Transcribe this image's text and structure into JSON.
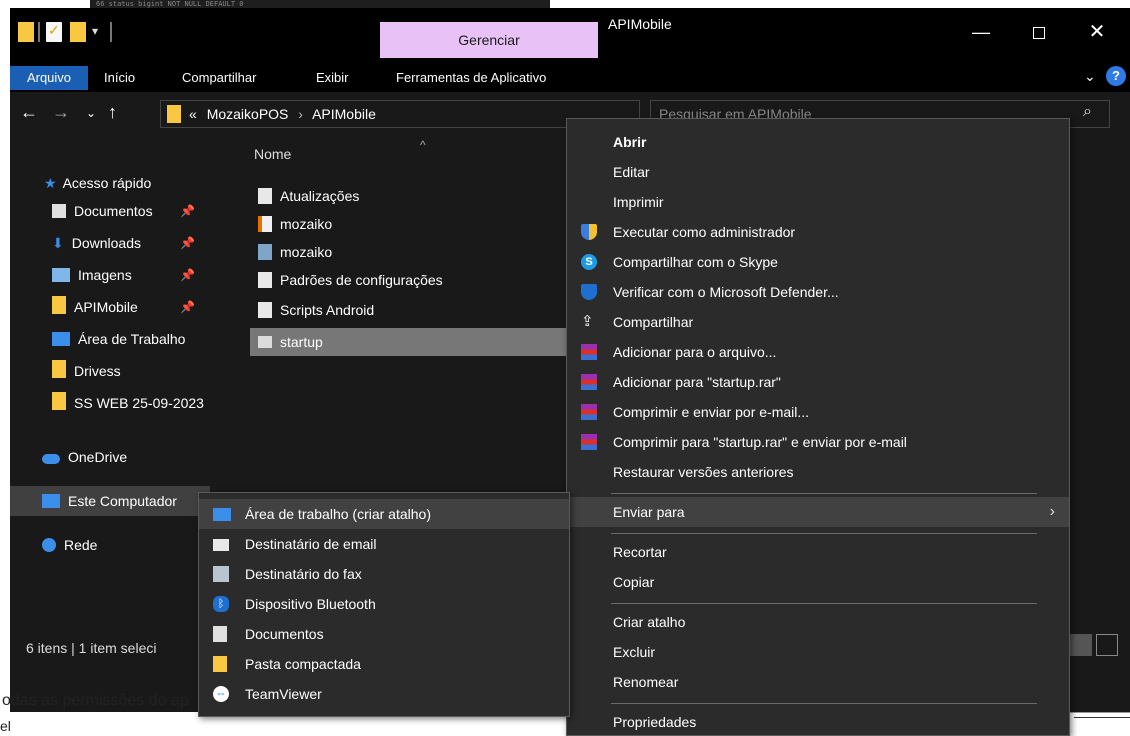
{
  "background": {
    "code_snippet": "66    status bigint NOT NULL DEFAULT 0",
    "under_text": "odas as permissões do ap",
    "under_text2": "el"
  },
  "window": {
    "title": "APIMobile",
    "manage_tab": "Gerenciar",
    "quick_access_dropdown": "▾"
  },
  "ribbon": {
    "tabs": [
      {
        "label": "Arquivo"
      },
      {
        "label": "Início"
      },
      {
        "label": "Compartilhar"
      },
      {
        "label": "Exibir"
      },
      {
        "label": "Ferramentas de Aplicativo"
      }
    ],
    "help": "?"
  },
  "address": {
    "path_prefix": "«",
    "path": [
      "MozaikoPOS",
      "APIMobile"
    ],
    "search_placeholder": "Pesquisar em APIMobile"
  },
  "navigation": {
    "items": [
      {
        "label": "Acesso rápido",
        "icon": "star-icon",
        "pinned": false
      },
      {
        "label": "Documentos",
        "icon": "documents-icon",
        "pinned": true
      },
      {
        "label": "Downloads",
        "icon": "download-icon",
        "pinned": true
      },
      {
        "label": "Imagens",
        "icon": "images-icon",
        "pinned": true
      },
      {
        "label": "APIMobile",
        "icon": "folder-icon",
        "pinned": true
      },
      {
        "label": "Área de Trabalho",
        "icon": "desktop-icon",
        "pinned": false
      },
      {
        "label": "Drivess",
        "icon": "folder-icon",
        "pinned": false
      },
      {
        "label": "SS WEB 25-09-2023",
        "icon": "folder-icon",
        "pinned": false
      },
      {
        "label": "OneDrive",
        "icon": "onedrive-icon",
        "pinned": false
      },
      {
        "label": "Este Computador",
        "icon": "computer-icon",
        "pinned": false
      },
      {
        "label": "Rede",
        "icon": "network-icon",
        "pinned": false
      }
    ]
  },
  "files": {
    "column_name": "Nome",
    "items": [
      {
        "name": "Atualizações",
        "icon": "text-file-icon"
      },
      {
        "name": "mozaiko",
        "icon": "java-file-icon"
      },
      {
        "name": "mozaiko",
        "icon": "archive-file-icon"
      },
      {
        "name": "Padrões de configurações",
        "icon": "text-file-icon"
      },
      {
        "name": "Scripts Android",
        "icon": "text-file-icon"
      },
      {
        "name": "startup",
        "icon": "batch-file-icon",
        "selected": true
      }
    ]
  },
  "status": {
    "text": "6 itens  |  1 item seleci"
  },
  "context_menu": {
    "items": [
      {
        "label": "Abrir",
        "bold": true
      },
      {
        "label": "Editar"
      },
      {
        "label": "Imprimir"
      },
      {
        "label": "Executar como administrador",
        "icon": "shield-icon"
      },
      {
        "label": "Compartilhar com o Skype",
        "icon": "skype-icon"
      },
      {
        "label": "Verificar com o Microsoft Defender...",
        "icon": "defender-icon"
      },
      {
        "label": "Compartilhar",
        "icon": "share-icon"
      },
      {
        "label": "Adicionar para o arquivo...",
        "icon": "winrar-icon"
      },
      {
        "label": "Adicionar para \"startup.rar\"",
        "icon": "winrar-icon"
      },
      {
        "label": "Comprimir e enviar por e-mail...",
        "icon": "winrar-icon"
      },
      {
        "label": "Comprimir para \"startup.rar\" e enviar por e-mail",
        "icon": "winrar-icon"
      },
      {
        "label": "Restaurar versões anteriores"
      },
      {
        "label": "Enviar para",
        "submenu": true
      },
      {
        "label": "Recortar"
      },
      {
        "label": "Copiar"
      },
      {
        "label": "Criar atalho"
      },
      {
        "label": "Excluir"
      },
      {
        "label": "Renomear"
      },
      {
        "label": "Propriedades"
      }
    ],
    "submenu_arrow": "›"
  },
  "sendto_menu": {
    "items": [
      {
        "label": "Área de trabalho (criar atalho)",
        "icon": "desktop-icon"
      },
      {
        "label": "Destinatário de email",
        "icon": "mail-icon"
      },
      {
        "label": "Destinatário do fax",
        "icon": "fax-icon"
      },
      {
        "label": "Dispositivo Bluetooth",
        "icon": "bluetooth-icon"
      },
      {
        "label": "Documentos",
        "icon": "documents-icon"
      },
      {
        "label": "Pasta compactada",
        "icon": "zip-folder-icon"
      },
      {
        "label": "TeamViewer",
        "icon": "teamviewer-icon"
      }
    ]
  },
  "colors": {
    "window_bg": "#191919",
    "titlebar_bg": "#000000",
    "manage_tab_bg": "#e8c2f6",
    "arquivo_tab_bg": "#1a5fb4",
    "menu_bg": "#2b2b2b",
    "menu_highlight": "#414141",
    "folder_yellow": "#f8c842",
    "selected_file_bg": "#777777"
  }
}
